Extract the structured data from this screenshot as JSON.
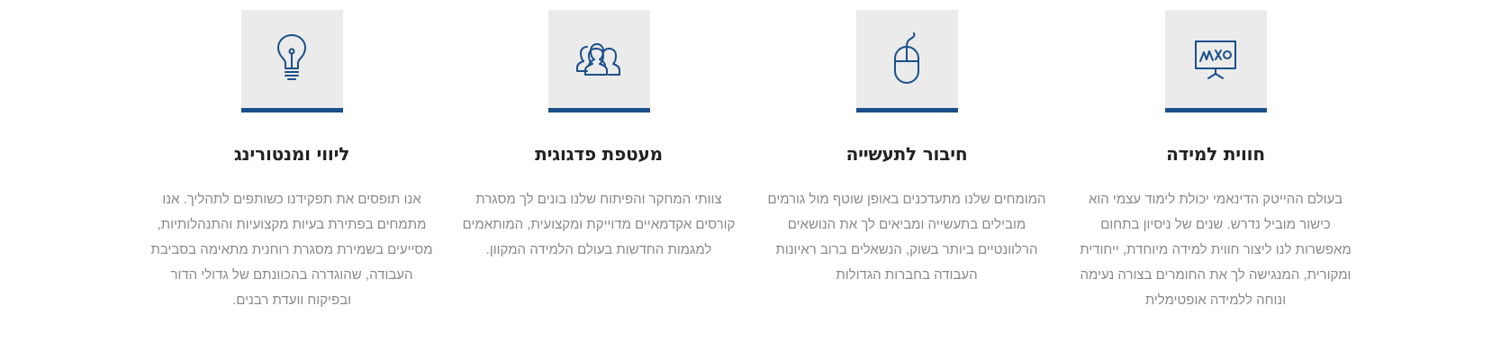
{
  "colors": {
    "accent": "#1a4f8a",
    "icon_bg": "#ebebeb",
    "title": "#222222",
    "text": "#8a8a8a"
  },
  "features": [
    {
      "icon": "presentation-board-icon",
      "title": "חווית למידה",
      "lines": [
        "בעולם ההייטק הדינאמי יכולת לימוד עצמי הוא",
        "כישור מוביל נדרש. שנים של ניסיון בתחום",
        "מאפשרות לנו ליצור חווית למידה מיוחדת, ייחודית",
        "ומקורית, המנגישה לך את החומרים בצורה נעימה",
        "ונוחה ללמידה אופטימלית"
      ]
    },
    {
      "icon": "computer-mouse-icon",
      "title": "חיבור לתעשייה",
      "lines": [
        "המומחים שלנו מתעדכנים באופן שוטף מול גורמים",
        "מובילים בתעשייה ומביאים לך את הנושאים",
        "הרלוונטיים ביותר בשוק, הנשאלים ברוב ראיונות",
        "העבודה בחברות הגדולות"
      ]
    },
    {
      "icon": "users-icon",
      "title": "מעטפת פדגוגית",
      "lines": [
        "צוותי המחקר והפיתוח שלנו בונים לך מסגרת",
        "קורסים אקדמאיים מדוייקת ומקצועית, המותאמים",
        "למגמות החדשות בעולם הלמידה המקוון."
      ]
    },
    {
      "icon": "lightbulb-icon",
      "title": "ליווי ומנטורינג",
      "lines": [
        "אנו תופסים את תפקידנו כשותפים לתהליך. אנו",
        "מתמחים בפתירת בעיות מקצועיות והתנהלותיות,",
        "מסייעים בשמירת מסגרת רוחנית מתאימה בסביבת",
        "העבודה, שהוגדרה בהכוונתם של גדולי הדור",
        "ובפיקוח וועדת רבנים."
      ]
    }
  ]
}
